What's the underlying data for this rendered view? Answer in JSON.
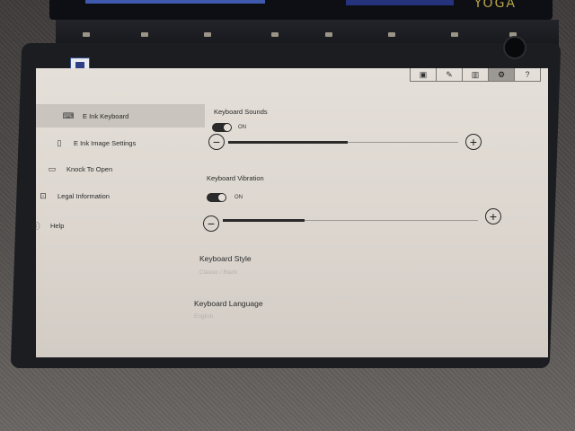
{
  "device": {
    "brand": "YOGA"
  },
  "toolbar": {
    "items": [
      {
        "icon": "monitor-icon",
        "glyph": "▣"
      },
      {
        "icon": "pen-icon",
        "glyph": "✎"
      },
      {
        "icon": "book-icon",
        "glyph": "▥"
      },
      {
        "icon": "gear-icon",
        "glyph": "⚙"
      },
      {
        "icon": "help-icon",
        "glyph": "?"
      }
    ],
    "active_index": 3
  },
  "sidebar": {
    "items": [
      {
        "label": "E Ink Keyboard",
        "icon": "keyboard-icon",
        "glyph": "⌨",
        "selected": true
      },
      {
        "label": "E Ink Image Settings",
        "icon": "image-icon",
        "glyph": "▯",
        "selected": false
      },
      {
        "label": "Knock To Open",
        "icon": "laptop-icon",
        "glyph": "▭",
        "selected": false
      },
      {
        "label": "Legal Information",
        "icon": "lock-icon",
        "glyph": "⊡",
        "selected": false
      },
      {
        "label": "Help",
        "icon": "info-icon",
        "glyph": "ⓘ",
        "selected": false
      }
    ]
  },
  "keyboard_sounds": {
    "title": "Keyboard Sounds",
    "toggle_label": "ON",
    "toggle_on": true,
    "level_fraction": 0.52
  },
  "keyboard_vibration": {
    "title": "Keyboard Vibration",
    "toggle_label": "ON",
    "toggle_on": true,
    "level_fraction": 0.32
  },
  "keyboard_style": {
    "title": "Keyboard Style",
    "value": "Classic / Black"
  },
  "keyboard_language": {
    "title": "Keyboard Language",
    "value": "English"
  },
  "controls": {
    "minus_glyph": "−",
    "plus_glyph": "+"
  }
}
